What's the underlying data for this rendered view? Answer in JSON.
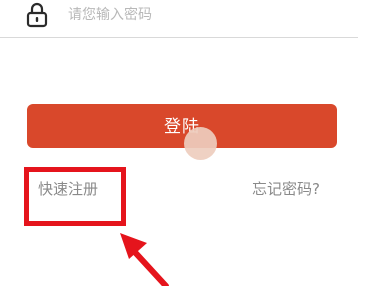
{
  "password_row": {
    "icon": "lock-icon",
    "placeholder": "请您输入密码"
  },
  "login_button": {
    "label": "登陆"
  },
  "links": {
    "quick_register": "快速注册",
    "forgot_password": "忘记密码?"
  },
  "colors": {
    "login_button_bg": "#d9482b",
    "highlight": "#e5141c",
    "link_text": "#8a8a8a"
  }
}
